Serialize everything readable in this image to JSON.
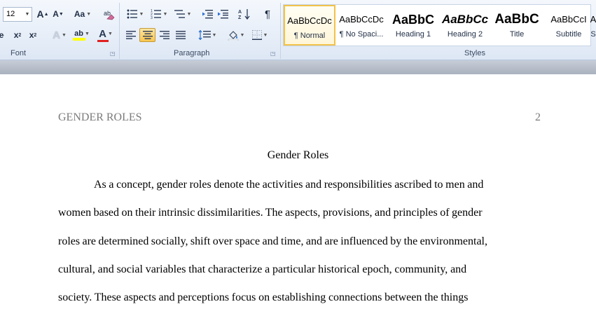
{
  "ribbon": {
    "font_group": {
      "label": "Font",
      "font_size": "12",
      "grow_font": "A",
      "shrink_font": "A",
      "change_case": "Aa",
      "font_color_letter": "A",
      "highlight_letters": "ab",
      "text_effect_letter": "A",
      "subscript": "x",
      "superscript": "x"
    },
    "paragraph_group": {
      "label": "Paragraph",
      "pilcrow": "¶"
    },
    "styles_group": {
      "label": "Styles",
      "items": [
        {
          "sample": "AaBbCcDc",
          "name": "¶ Normal"
        },
        {
          "sample": "AaBbCcDc",
          "name": "¶ No Spaci..."
        },
        {
          "sample": "AaBbC",
          "name": "Heading 1"
        },
        {
          "sample": "AaBbCc",
          "name": "Heading 2"
        },
        {
          "sample": "AaBbC",
          "name": "Title"
        },
        {
          "sample": "AaBbCcI",
          "name": "Subtitle"
        },
        {
          "sample": "A",
          "name": "S"
        }
      ]
    },
    "colors": {
      "font_color": "#e02020",
      "highlight_color": "#ffff00"
    }
  },
  "document": {
    "header_left": "GENDER ROLES",
    "header_right": "2",
    "title": "Gender Roles",
    "lines": [
      "As a concept, gender roles denote the activities and responsibilities ascribed to men and",
      "women based on their intrinsic dissimilarities.  The aspects, provisions, and principles of gender",
      "roles are determined socially, shift over space and time, and are influenced by the environmental,",
      "cultural, and social variables that characterize a particular historical epoch, community, and",
      "society. These aspects and perceptions focus on establishing connections between the things"
    ]
  }
}
